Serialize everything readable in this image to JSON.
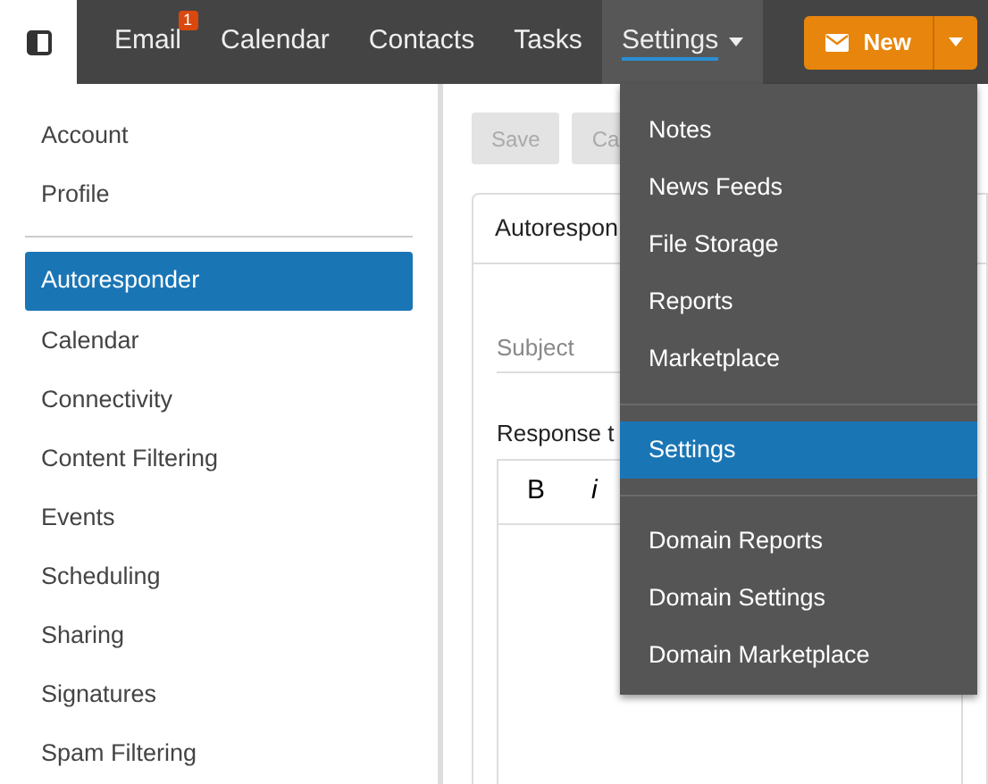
{
  "nav": [
    {
      "label": "Email",
      "badge": "1",
      "selected": false
    },
    {
      "label": "Calendar",
      "selected": false
    },
    {
      "label": "Contacts",
      "selected": false
    },
    {
      "label": "Tasks",
      "selected": false
    },
    {
      "label": "Settings",
      "selected": true,
      "dropdown": true
    }
  ],
  "new_button": {
    "label": "New"
  },
  "sidebar": {
    "groups": [
      [
        {
          "label": "Account",
          "selected": false
        },
        {
          "label": "Profile",
          "selected": false
        }
      ],
      [
        {
          "label": "Autoresponder",
          "selected": true
        },
        {
          "label": "Calendar",
          "selected": false
        },
        {
          "label": "Connectivity",
          "selected": false
        },
        {
          "label": "Content Filtering",
          "selected": false
        },
        {
          "label": "Events",
          "selected": false
        },
        {
          "label": "Scheduling",
          "selected": false
        },
        {
          "label": "Sharing",
          "selected": false
        },
        {
          "label": "Signatures",
          "selected": false
        },
        {
          "label": "Spam Filtering",
          "selected": false
        }
      ]
    ]
  },
  "toolbar": {
    "buttons": [
      "Save",
      "Ca"
    ]
  },
  "card": {
    "title": "Autorespon",
    "subject": {
      "placeholder": "Subject"
    },
    "response_label": "Response t",
    "editor_tools": [
      "B",
      "i"
    ]
  },
  "menu": {
    "groups": [
      [
        {
          "label": "Notes",
          "selected": false
        },
        {
          "label": "News Feeds",
          "selected": false
        },
        {
          "label": "File Storage",
          "selected": false
        },
        {
          "label": "Reports",
          "selected": false
        },
        {
          "label": "Marketplace",
          "selected": false
        }
      ],
      [
        {
          "label": "Settings",
          "selected": true
        }
      ],
      [
        {
          "label": "Domain Reports",
          "selected": false
        },
        {
          "label": "Domain Settings",
          "selected": false
        },
        {
          "label": "Domain Marketplace",
          "selected": false
        }
      ]
    ]
  }
}
